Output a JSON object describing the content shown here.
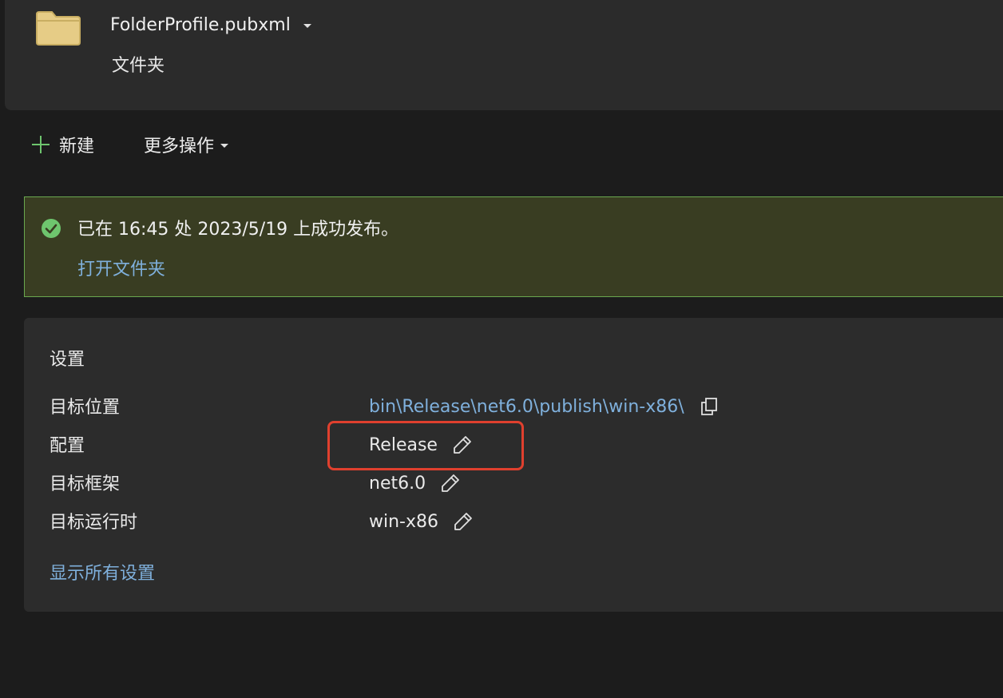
{
  "profile": {
    "name": "FolderProfile.pubxml",
    "type": "文件夹"
  },
  "commands": {
    "new_label": "新建",
    "more_label": "更多操作"
  },
  "banner": {
    "message": "已在 16:45 处 2023/5/19 上成功发布。",
    "link": "打开文件夹"
  },
  "settings": {
    "title": "设置",
    "rows": [
      {
        "label": "目标位置",
        "value": "bin\\Release\\net6.0\\publish\\win-x86\\",
        "action_icon": "copy-icon"
      },
      {
        "label": "配置",
        "value": "Release",
        "action_icon": "edit-icon"
      },
      {
        "label": "目标框架",
        "value": "net6.0",
        "action_icon": "edit-icon"
      },
      {
        "label": "目标运行时",
        "value": "win-x86",
        "action_icon": "edit-icon"
      }
    ],
    "show_all_link": "显示所有设置"
  },
  "colors": {
    "background": "#1c1c1c",
    "card": "#2b2b2b",
    "banner_bg": "#393d22",
    "banner_border": "#6aa84f",
    "success": "#6ec56e",
    "link": "#7fb0dc",
    "highlight": "#e0402e",
    "folder": "#e8d08a"
  }
}
